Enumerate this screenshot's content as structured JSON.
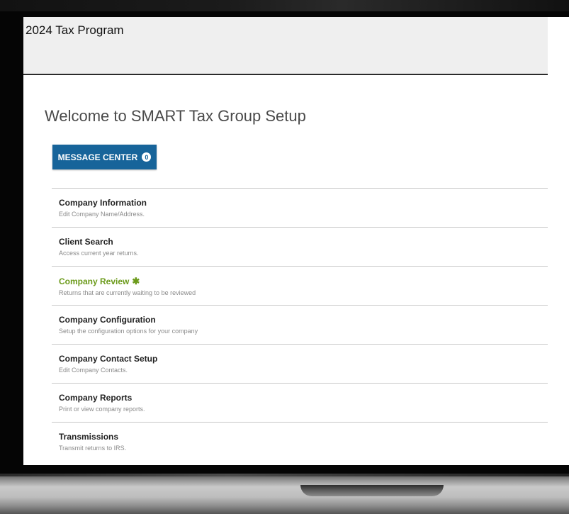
{
  "app": {
    "title": "2024 Tax Program"
  },
  "main": {
    "welcome": "Welcome to SMART Tax Group Setup",
    "message_center": {
      "label": "MESSAGE CENTER",
      "count": "0"
    }
  },
  "menu": {
    "items": [
      {
        "title": "Company Information",
        "subtitle": "Edit Company Name/Address."
      },
      {
        "title": "Client Search",
        "subtitle": "Access current year returns."
      },
      {
        "title": "Company Review",
        "subtitle": "Returns that are currently waiting to be reviewed",
        "highlight_color": "#6b9a1a",
        "icon": "asterisk-icon"
      },
      {
        "title": "Company Configuration",
        "subtitle": "Setup the configuration options for your company"
      },
      {
        "title": "Company Contact Setup",
        "subtitle": "Edit Company Contacts."
      },
      {
        "title": "Company Reports",
        "subtitle": "Print or view company reports."
      },
      {
        "title": "Transmissions",
        "subtitle": "Transmit returns to IRS."
      }
    ]
  },
  "colors": {
    "accent": "#17649a",
    "highlight": "#6b9a1a"
  }
}
